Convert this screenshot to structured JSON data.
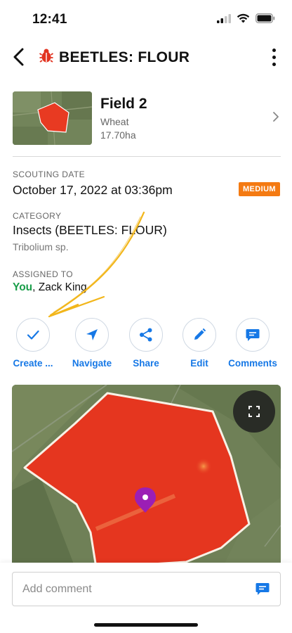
{
  "status_bar": {
    "time": "12:41"
  },
  "nav": {
    "title": "BEETLES: FLOUR",
    "title_icon": "bug-icon"
  },
  "field": {
    "name": "Field 2",
    "crop": "Wheat",
    "area": "17.70ha"
  },
  "scouting": {
    "label": "SCOUTING DATE",
    "value": "October 17, 2022 at 03:36pm",
    "severity": "MEDIUM",
    "severity_color": "#f47a12"
  },
  "category": {
    "label": "CATEGORY",
    "value": "Insects (BEETLES: FLOUR)",
    "species": "Tribolium sp."
  },
  "assigned": {
    "label": "ASSIGNED TO",
    "you": "You",
    "others": ", Zack King"
  },
  "actions": [
    {
      "label": "Create ...",
      "icon": "check-icon"
    },
    {
      "label": "Navigate",
      "icon": "navigate-arrow-icon"
    },
    {
      "label": "Share",
      "icon": "share-icon"
    },
    {
      "label": "Edit",
      "icon": "pencil-icon"
    },
    {
      "label": "Comments",
      "icon": "comment-bubble-icon"
    }
  ],
  "colors": {
    "accent": "#1678e6",
    "assigned_you": "#1a9e4a",
    "pin": "#9b1fb5",
    "annotation_arrow": "#f2b61b",
    "map_overlay": "#e5361f"
  },
  "comment": {
    "placeholder": "Add comment"
  }
}
